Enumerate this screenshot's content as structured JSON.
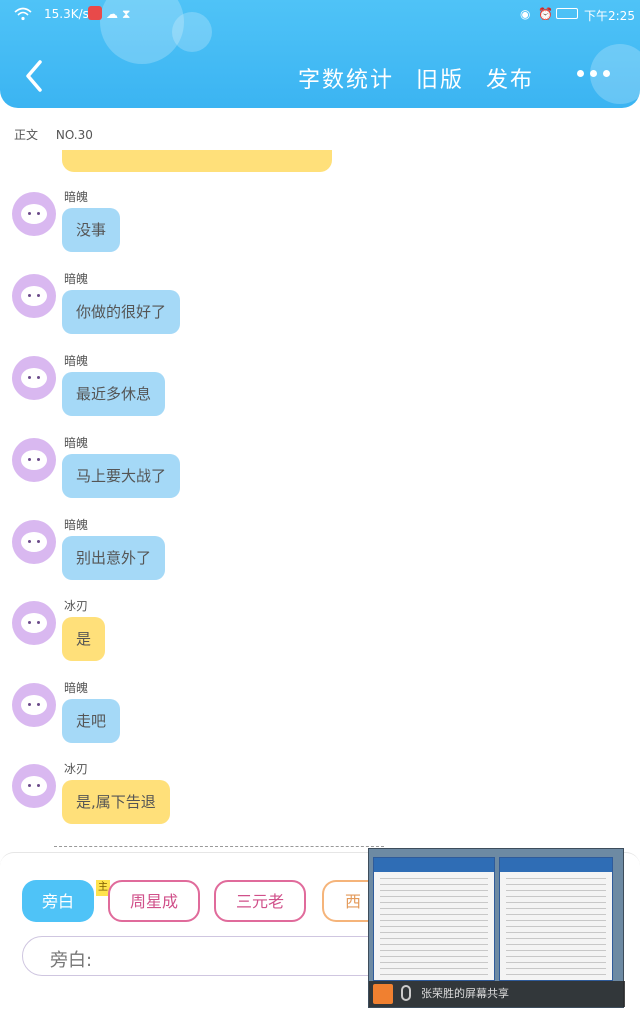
{
  "status_bar": {
    "net_speed": "15.3K/s",
    "time": "下午2:25"
  },
  "header": {
    "actions": [
      "字数统计",
      "旧版",
      "发布"
    ],
    "colors": {
      "header_bg": "#3bb4f2"
    }
  },
  "chapter": {
    "label": "正文",
    "number": "NO.30"
  },
  "messages": [
    {
      "sender": "暗魄",
      "text": "没事",
      "style": "blue"
    },
    {
      "sender": "暗魄",
      "text": "你做的很好了",
      "style": "blue"
    },
    {
      "sender": "暗魄",
      "text": "最近多休息",
      "style": "blue"
    },
    {
      "sender": "暗魄",
      "text": "马上要大战了",
      "style": "blue"
    },
    {
      "sender": "暗魄",
      "text": "别出意外了",
      "style": "blue"
    },
    {
      "sender": "冰刃",
      "text": "是",
      "style": "yellow"
    },
    {
      "sender": "暗魄",
      "text": "走吧",
      "style": "blue"
    },
    {
      "sender": "冰刃",
      "text": "是,属下告退",
      "style": "yellow"
    }
  ],
  "roles": {
    "chips": [
      "旁白",
      "周星成",
      "三元老",
      "西"
    ],
    "main_tag": "主"
  },
  "input": {
    "label": "旁白:"
  },
  "screen_share": {
    "caption": "张荣胜的屏幕共享"
  }
}
